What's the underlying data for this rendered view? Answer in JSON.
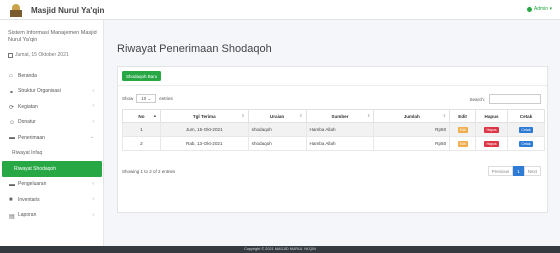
{
  "app": {
    "title": "Masjid Nurul Ya'qin",
    "user": "Admin"
  },
  "sidebar": {
    "system_name": "Sistem Informasi Manajemen Masjid Nurul Ya'qin",
    "date": "Jumat, 15 Oktober 2021",
    "items": [
      {
        "label": "Beranda",
        "icon": "home-icon",
        "chevron": ""
      },
      {
        "label": "Struktur Organisasi",
        "icon": "sitemap-icon",
        "chevron": "‹"
      },
      {
        "label": "Kegiatan",
        "icon": "sync-icon",
        "chevron": "‹"
      },
      {
        "label": "Donatur",
        "icon": "users-icon",
        "chevron": "‹"
      },
      {
        "label": "Penerimaan",
        "icon": "folder-icon",
        "chevron": "⌄"
      },
      {
        "label": "Riwayat Infaq",
        "icon": "",
        "chevron": "",
        "sub": true
      },
      {
        "label": "Riwayat Shodaqoh",
        "icon": "",
        "chevron": "",
        "sub": true,
        "active": true
      },
      {
        "label": "Pengeluaran",
        "icon": "folder-icon",
        "chevron": "‹"
      },
      {
        "label": "Inventaris",
        "icon": "box-icon",
        "chevron": "‹"
      },
      {
        "label": "Laporan",
        "icon": "book-icon",
        "chevron": "‹"
      }
    ]
  },
  "main": {
    "title": "Riwayat Penerimaan Shodaqoh",
    "add_button": "Shodaqoh Baru",
    "show_label": "Show",
    "show_value": "10",
    "entries_label": "entries",
    "search_label": "Search:",
    "columns": [
      "No",
      "Tgl Terima",
      "Uraian",
      "Sumber",
      "Jumlah",
      "Edit",
      "Hapus",
      "Cetak"
    ],
    "rows": [
      {
        "no": "1",
        "tgl": "Jum, 15-Okt-2021",
        "uraian": "shodaqoh",
        "sumber": "Hamba Allah",
        "jumlah": "Rp50",
        "edit": "Edit",
        "hapus": "Hapus",
        "cetak": "Cetak"
      },
      {
        "no": "2",
        "tgl": "Rab, 13-Okt-2021",
        "uraian": "shodaqoh",
        "sumber": "Hamba Allah",
        "jumlah": "Rp50",
        "edit": "Edit",
        "hapus": "Hapus",
        "cetak": "Cetak"
      }
    ],
    "info": "Showing 1 to 2 of 2 entries",
    "pager": {
      "prev": "Previous",
      "current": "1",
      "next": "Next"
    }
  },
  "footer": {
    "text": "Copyright © 2021 MASJID NURUL YA'QIN"
  },
  "colors": {
    "accent": "#28a745",
    "edit": "#f0ad4e",
    "delete": "#dc3545",
    "print": "#2e7bd6"
  }
}
